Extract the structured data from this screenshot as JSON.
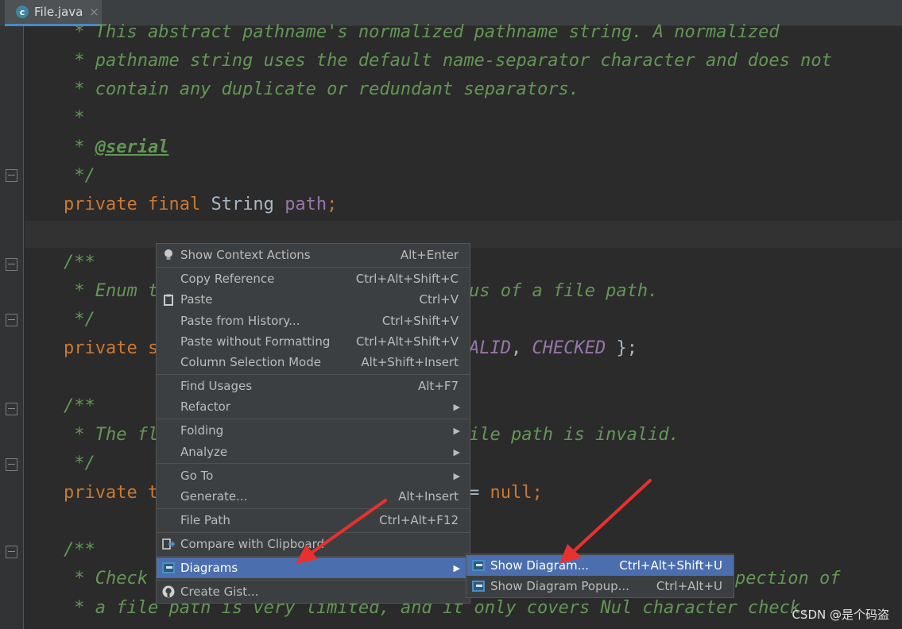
{
  "tab": {
    "name": "File.java",
    "icon_letter": "c",
    "close": "×"
  },
  "code_lines": [
    " * This abstract pathname's normalized pathname string. A normalized",
    " * pathname string uses the default name-separator character and does not",
    " * contain any duplicate or redundant separators.",
    " *",
    " * ",
    " */",
    "",
    "",
    "/**",
    " * Enum t",
    " */",
    "private s",
    "",
    "/**",
    " * The fl",
    " */",
    "private t",
    "",
    "/**",
    " * Check",
    " * a file path is very limited, and it only covers Nul character check."
  ],
  "code": {
    "serial_tag": "@serial",
    "kw_private": "private",
    "kw_final": "final",
    "type_string": "String",
    "field_path": "path",
    "semicolon": ";",
    "enum_tail": "us of a file path.",
    "alid": "ALID",
    "comma": ", ",
    "checked": "CHECKED",
    "brace": " };",
    "invalid_tail": "ile path is invalid.",
    "null_prefix": "= ",
    "null_kw": "null",
    "inspection_tail": "pection of"
  },
  "menu": {
    "items": [
      {
        "label": "Show Context Actions",
        "shortcut": "Alt+Enter",
        "icon": "lightbulb-icon"
      },
      {
        "label": "Copy Reference",
        "shortcut": "Ctrl+Alt+Shift+C"
      },
      {
        "label": "Paste",
        "shortcut": "Ctrl+V",
        "icon": "clipboard-icon"
      },
      {
        "label": "Paste from History...",
        "shortcut": "Ctrl+Shift+V"
      },
      {
        "label": "Paste without Formatting",
        "shortcut": "Ctrl+Alt+Shift+V"
      },
      {
        "label": "Column Selection Mode",
        "shortcut": "Alt+Shift+Insert"
      },
      {
        "label": "Find Usages",
        "shortcut": "Alt+F7"
      },
      {
        "label": "Refactor",
        "submenu": true
      },
      {
        "label": "Folding",
        "submenu": true
      },
      {
        "label": "Analyze",
        "submenu": true
      },
      {
        "label": "Go To",
        "submenu": true
      },
      {
        "label": "Generate...",
        "shortcut": "Alt+Insert"
      },
      {
        "label": "File Path",
        "shortcut": "Ctrl+Alt+F12"
      },
      {
        "label": "Compare with Clipboard",
        "icon": "compare-icon"
      },
      {
        "label": "Diagrams",
        "submenu": true,
        "selected": true,
        "icon": "diagram-icon"
      },
      {
        "label": "Create Gist...",
        "icon": "github-icon"
      }
    ]
  },
  "submenu": {
    "items": [
      {
        "label": "Show Diagram...",
        "shortcut": "Ctrl+Alt+Shift+U",
        "selected": true
      },
      {
        "label": "Show Diagram Popup...",
        "shortcut": "Ctrl+Alt+U"
      }
    ]
  },
  "watermark": "CSDN @是个码盗",
  "colors": {
    "accent": "#4b6eaf",
    "arrow": "#e8312f",
    "doc_comment": "#629755",
    "keyword": "#cc7832"
  }
}
